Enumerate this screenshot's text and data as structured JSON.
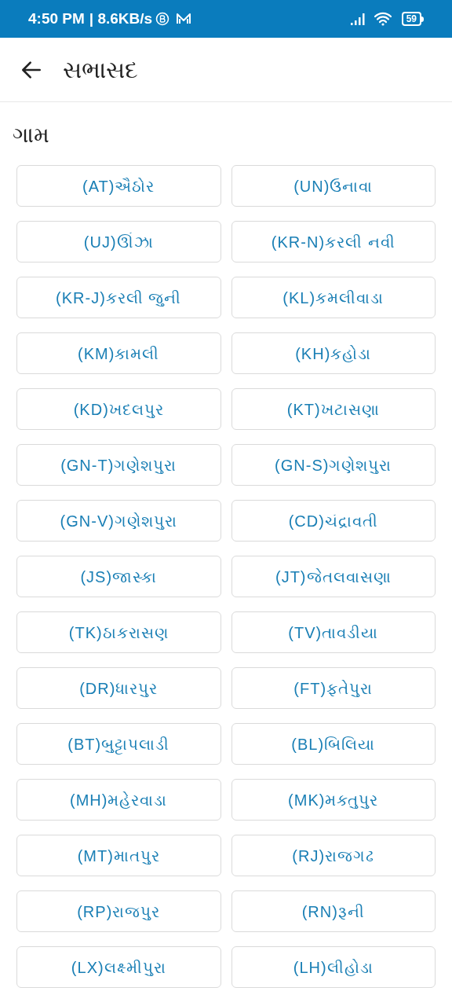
{
  "status_bar": {
    "time": "4:50 PM",
    "speed": "| 8.6KB/s",
    "battery": "59"
  },
  "app_bar": {
    "title": "સભાસદ"
  },
  "section": {
    "title": "ગામ"
  },
  "villages": [
    {
      "label": "(AT)ઐઠોર"
    },
    {
      "label": "(UN)ઉનાવા"
    },
    {
      "label": "(UJ)ઊંઝા"
    },
    {
      "label": "(KR-N)કરલી નવી"
    },
    {
      "label": "(KR-J)કરલી જુની"
    },
    {
      "label": "(KL)કમલીવાડા"
    },
    {
      "label": "(KM)કામલી"
    },
    {
      "label": "(KH)કહોડા"
    },
    {
      "label": "(KD)ખદલપુર"
    },
    {
      "label": "(KT)ખટાસણા"
    },
    {
      "label": "(GN-T)ગણેશપુરા"
    },
    {
      "label": "(GN-S)ગણેશપુરા"
    },
    {
      "label": "(GN-V)ગણેશપુરા"
    },
    {
      "label": "(CD)ચંદ્રાવતી"
    },
    {
      "label": "(JS)જાસ્કા"
    },
    {
      "label": "(JT)જેતલવાસણા"
    },
    {
      "label": "(TK)ઠાકરાસણ"
    },
    {
      "label": "(TV)તાવડીયા"
    },
    {
      "label": "(DR)ધારપુર"
    },
    {
      "label": "(FT)ફતેપુરા"
    },
    {
      "label": "(BT)બુટ્ટાપલાડી"
    },
    {
      "label": "(BL)બિલિયા"
    },
    {
      "label": "(MH)મહેરવાડા"
    },
    {
      "label": "(MK)મક્તુપુર"
    },
    {
      "label": "(MT)માતપુર"
    },
    {
      "label": "(RJ)રાજગઢ"
    },
    {
      "label": "(RP)રાજપુર"
    },
    {
      "label": "(RN)રૂની"
    },
    {
      "label": "(LX)લક્ષ્મીપુરા"
    },
    {
      "label": "(LH)લીહોડા"
    }
  ]
}
